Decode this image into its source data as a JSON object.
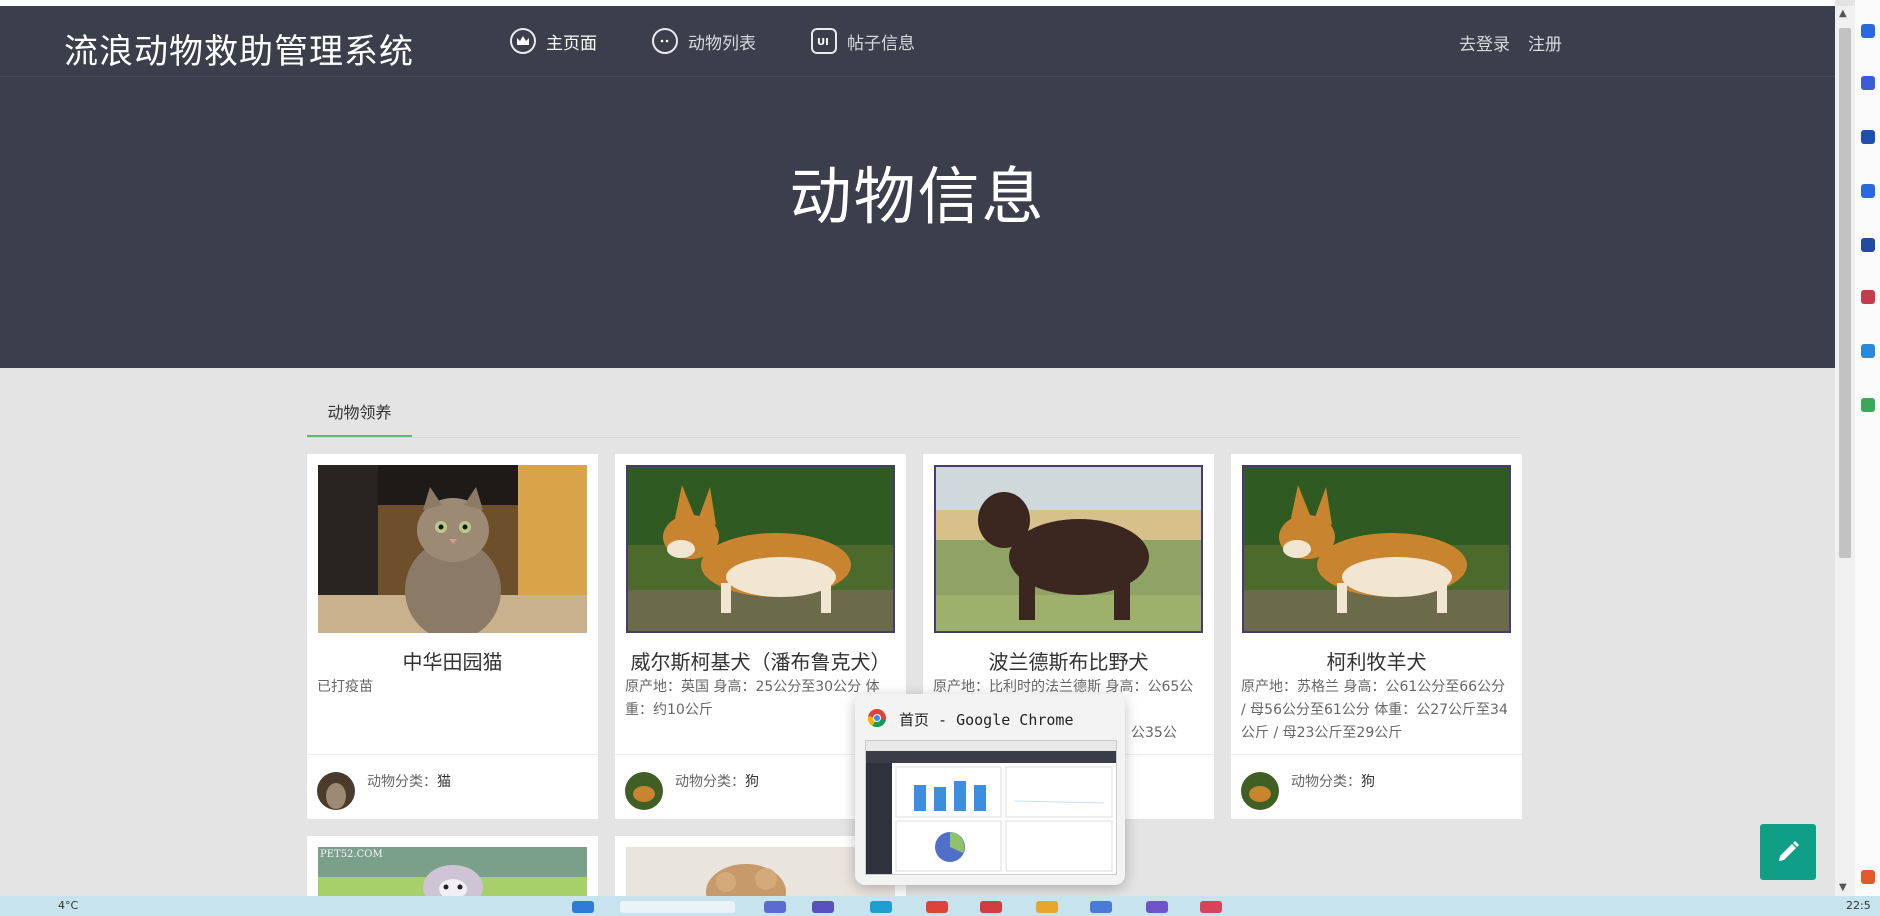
{
  "brand": "流浪动物救助管理系统",
  "nav": [
    {
      "label": "主页面",
      "icon": "crown-icon"
    },
    {
      "label": "动物列表",
      "icon": "chat-bubble-icon"
    },
    {
      "label": "帖子信息",
      "icon": "ui-shield-icon"
    }
  ],
  "auth": {
    "login": "去登录",
    "register": "注册"
  },
  "hero_title": "动物信息",
  "tab_label": "动物领养",
  "category_label": "动物分类：",
  "cards": [
    {
      "title": "中华田园猫",
      "desc": "已打疫苗",
      "category": "猫"
    },
    {
      "title": "威尔斯柯基犬（潘布鲁克犬）",
      "desc": "原产地：英国 身高：25公分至30公分 体重：约10公斤",
      "category": "狗"
    },
    {
      "title": "波兰德斯布比野犬",
      "desc": "原产地：比利时的法兰德斯 身高：公65公分",
      "desc2": "重：公35公",
      "category": ""
    },
    {
      "title": "柯利牧羊犬",
      "desc": "原产地：苏格兰 身高：公61公分至66公分 / 母56公分至61公分 体重：公27公斤至34公斤 / 母23公斤至29公斤",
      "category": "狗"
    }
  ],
  "partial_cards": [
    {
      "watermark": "PET52.COM"
    },
    {
      "watermark": ""
    }
  ],
  "popup": {
    "title": "首页 - Google Chrome"
  },
  "taskbar": {
    "temp": "4°C",
    "time": "22:5"
  },
  "colors": {
    "header": "#3b3f4b",
    "accent": "#5fb878",
    "fab": "#0f9f86"
  }
}
